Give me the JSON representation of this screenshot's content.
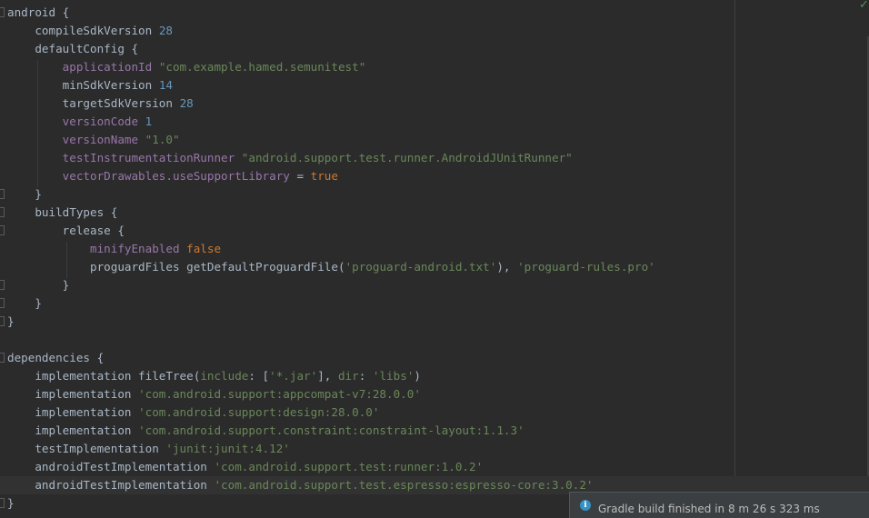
{
  "editor": {
    "status_icon": "check-icon",
    "lines": [
      {
        "fold": true,
        "segments": [
          {
            "t": "k",
            "v": "android {"
          }
        ]
      },
      {
        "segments": [
          {
            "t": "k",
            "v": "    compileSdkVersion "
          },
          {
            "t": "n",
            "v": "28"
          }
        ]
      },
      {
        "segments": [
          {
            "t": "k",
            "v": "    defaultConfig {"
          }
        ]
      },
      {
        "segments": [
          {
            "t": "p",
            "v": "        applicationId "
          },
          {
            "t": "s",
            "v": "\"com.example.hamed.semunitest\""
          }
        ]
      },
      {
        "segments": [
          {
            "t": "k",
            "v": "        minSdkVersion "
          },
          {
            "t": "n",
            "v": "14"
          }
        ]
      },
      {
        "segments": [
          {
            "t": "k",
            "v": "        targetSdkVersion "
          },
          {
            "t": "n",
            "v": "28"
          }
        ]
      },
      {
        "segments": [
          {
            "t": "p",
            "v": "        versionCode "
          },
          {
            "t": "n",
            "v": "1"
          }
        ]
      },
      {
        "segments": [
          {
            "t": "p",
            "v": "        versionName "
          },
          {
            "t": "s",
            "v": "\"1.0\""
          }
        ]
      },
      {
        "segments": [
          {
            "t": "p",
            "v": "        testInstrumentationRunner "
          },
          {
            "t": "s",
            "v": "\"android.support.test.runner.AndroidJUnitRunner\""
          }
        ]
      },
      {
        "segments": [
          {
            "t": "p",
            "v": "        vectorDrawables.useSupportLibrary "
          },
          {
            "t": "k",
            "v": "= "
          },
          {
            "t": "kw",
            "v": "true"
          }
        ]
      },
      {
        "fold": true,
        "segments": [
          {
            "t": "k",
            "v": "    }"
          }
        ]
      },
      {
        "fold": true,
        "segments": [
          {
            "t": "k",
            "v": "    buildTypes {"
          }
        ]
      },
      {
        "fold": true,
        "segments": [
          {
            "t": "k",
            "v": "        release {"
          }
        ]
      },
      {
        "segments": [
          {
            "t": "p",
            "v": "            minifyEnabled "
          },
          {
            "t": "kw",
            "v": "false"
          }
        ]
      },
      {
        "segments": [
          {
            "t": "k",
            "v": "            proguardFiles getDefaultProguardFile("
          },
          {
            "t": "s",
            "v": "'proguard-android.txt'"
          },
          {
            "t": "k",
            "v": "), "
          },
          {
            "t": "s",
            "v": "'proguard-rules.pro'"
          }
        ]
      },
      {
        "fold": true,
        "segments": [
          {
            "t": "k",
            "v": "        }"
          }
        ]
      },
      {
        "fold": true,
        "segments": [
          {
            "t": "k",
            "v": "    }"
          }
        ]
      },
      {
        "fold": true,
        "segments": [
          {
            "t": "k",
            "v": "}"
          }
        ]
      },
      {
        "segments": []
      },
      {
        "fold": true,
        "segments": [
          {
            "t": "k",
            "v": "dependencies {"
          }
        ]
      },
      {
        "segments": [
          {
            "t": "k",
            "v": "    implementation fileTree("
          },
          {
            "t": "s",
            "v": "include"
          },
          {
            "t": "k",
            "v": ": ["
          },
          {
            "t": "s",
            "v": "'*.jar'"
          },
          {
            "t": "k",
            "v": "], "
          },
          {
            "t": "s",
            "v": "dir"
          },
          {
            "t": "k",
            "v": ": "
          },
          {
            "t": "s",
            "v": "'libs'"
          },
          {
            "t": "k",
            "v": ")"
          }
        ]
      },
      {
        "segments": [
          {
            "t": "k",
            "v": "    implementation "
          },
          {
            "t": "s",
            "v": "'com.android.support:appcompat-v7:28.0.0'"
          }
        ]
      },
      {
        "segments": [
          {
            "t": "k",
            "v": "    implementation "
          },
          {
            "t": "s",
            "v": "'com.android.support:design:28.0.0'"
          }
        ]
      },
      {
        "segments": [
          {
            "t": "k",
            "v": "    implementation "
          },
          {
            "t": "s",
            "v": "'com.android.support.constraint:constraint-layout:1.1.3'"
          }
        ]
      },
      {
        "segments": [
          {
            "t": "k",
            "v": "    testImplementation "
          },
          {
            "t": "s",
            "v": "'junit:junit:4.12'"
          }
        ]
      },
      {
        "segments": [
          {
            "t": "k",
            "v": "    androidTestImplementation "
          },
          {
            "t": "s",
            "v": "'com.android.support.test:runner:1.0.2'"
          }
        ]
      },
      {
        "current": true,
        "segments": [
          {
            "t": "k",
            "v": "    androidTestImplementation "
          },
          {
            "t": "s",
            "v": "'com.android.support.test.espresso:espresso-core:3.0.2'"
          }
        ]
      },
      {
        "fold": true,
        "segments": [
          {
            "t": "k",
            "v": "}"
          }
        ]
      }
    ]
  },
  "notification": {
    "icon": "info-icon",
    "text": "Gradle build finished in 8 m 26 s 323 ms"
  }
}
